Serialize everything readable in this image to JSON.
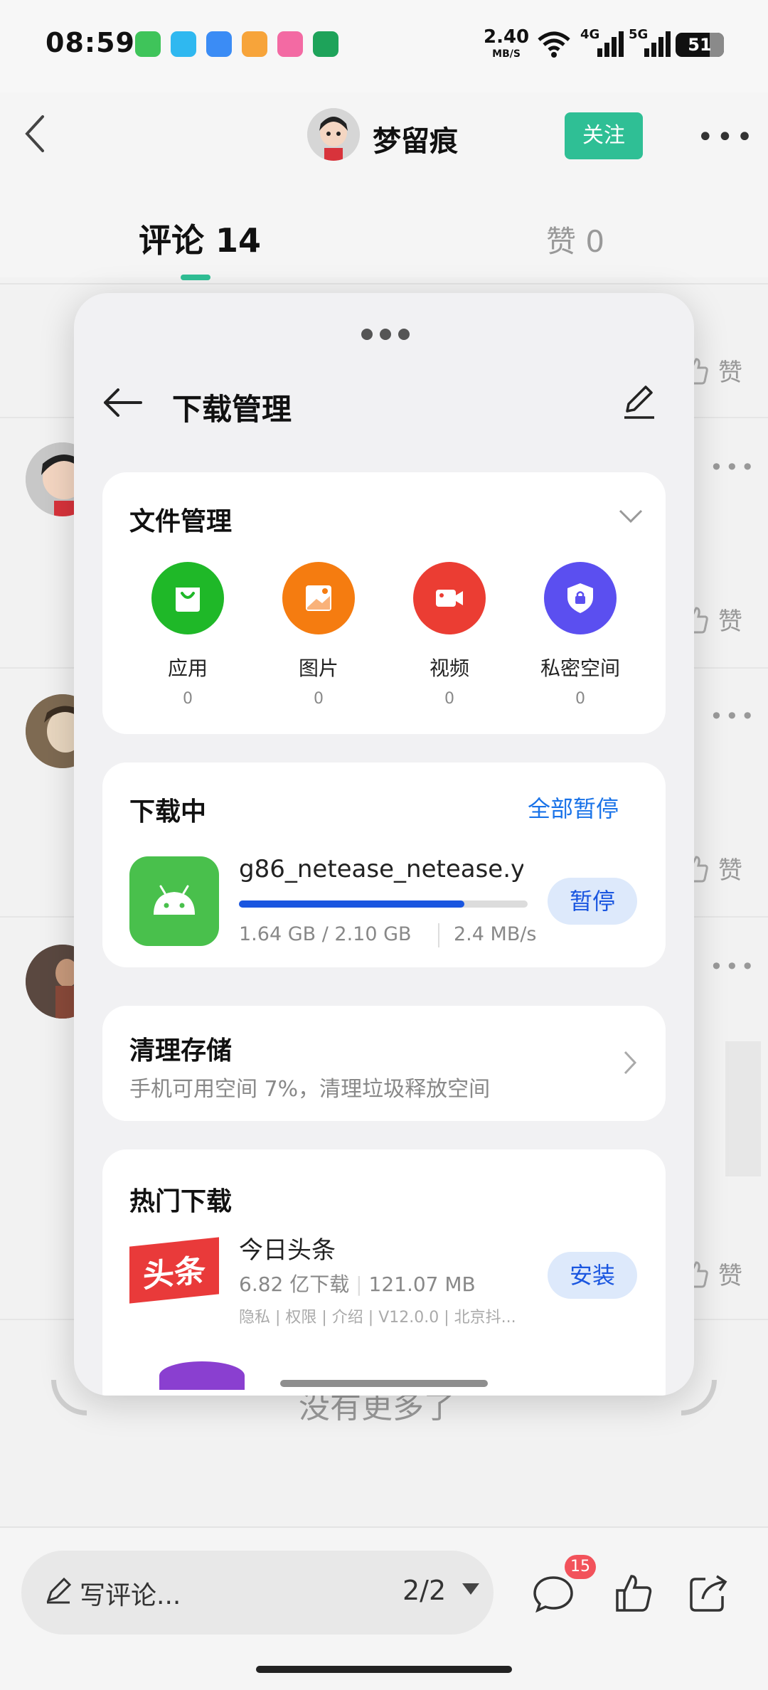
{
  "status_bar": {
    "time": "08:59",
    "net_speed_value": "2.40",
    "net_speed_unit": "MB/S",
    "signal_1_label": "4G",
    "signal_2_label": "5G",
    "battery": "51",
    "app_icon_colors": [
      "#3fc45a",
      "#2fb8f0",
      "#3b8cf5",
      "#f7a43a",
      "#f36aa3",
      "#1ea35a"
    ]
  },
  "header": {
    "author_name": "梦留痕",
    "follow_label": "关注",
    "more_icon": "more-horizontal-icon",
    "tab_comments": "评论 14",
    "tab_likes": "赞 0"
  },
  "background_list": {
    "like_label": "赞",
    "no_more_text": "没有更多了"
  },
  "bottom_bar": {
    "comment_placeholder": "写评论...",
    "page_indicator": "2/2",
    "comment_badge": "15"
  },
  "download_manager": {
    "title": "下载管理",
    "file_management": {
      "title": "文件管理",
      "categories": [
        {
          "label": "应用",
          "count": "0",
          "color": "#1fb828",
          "icon": "shopping-bag-icon"
        },
        {
          "label": "图片",
          "count": "0",
          "color": "#f57c10",
          "icon": "image-icon"
        },
        {
          "label": "视频",
          "count": "0",
          "color": "#eb3d33",
          "icon": "video-icon"
        },
        {
          "label": "私密空间",
          "count": "0",
          "color": "#5b4ff0",
          "icon": "lock-shield-icon"
        }
      ]
    },
    "downloading": {
      "title": "下载中",
      "pause_all_label": "全部暂停",
      "item": {
        "name": "g86_netease_netease.y...",
        "size": "1.64 GB / 2.10 GB",
        "speed": "2.4 MB/s",
        "progress": 0.78,
        "pause_label": "暂停"
      }
    },
    "clean_storage": {
      "title": "清理存储",
      "subtitle": "手机可用空间 7%，清理垃圾释放空间"
    },
    "hot_downloads": {
      "title": "热门下载",
      "item": {
        "logo_text": "头条",
        "name": "今日头条",
        "downloads": "6.82 亿下载",
        "size": "121.07 MB",
        "tags": "隐私 | 权限 | 介绍 | V12.0.0 | 北京抖...",
        "install_label": "安装"
      }
    }
  }
}
